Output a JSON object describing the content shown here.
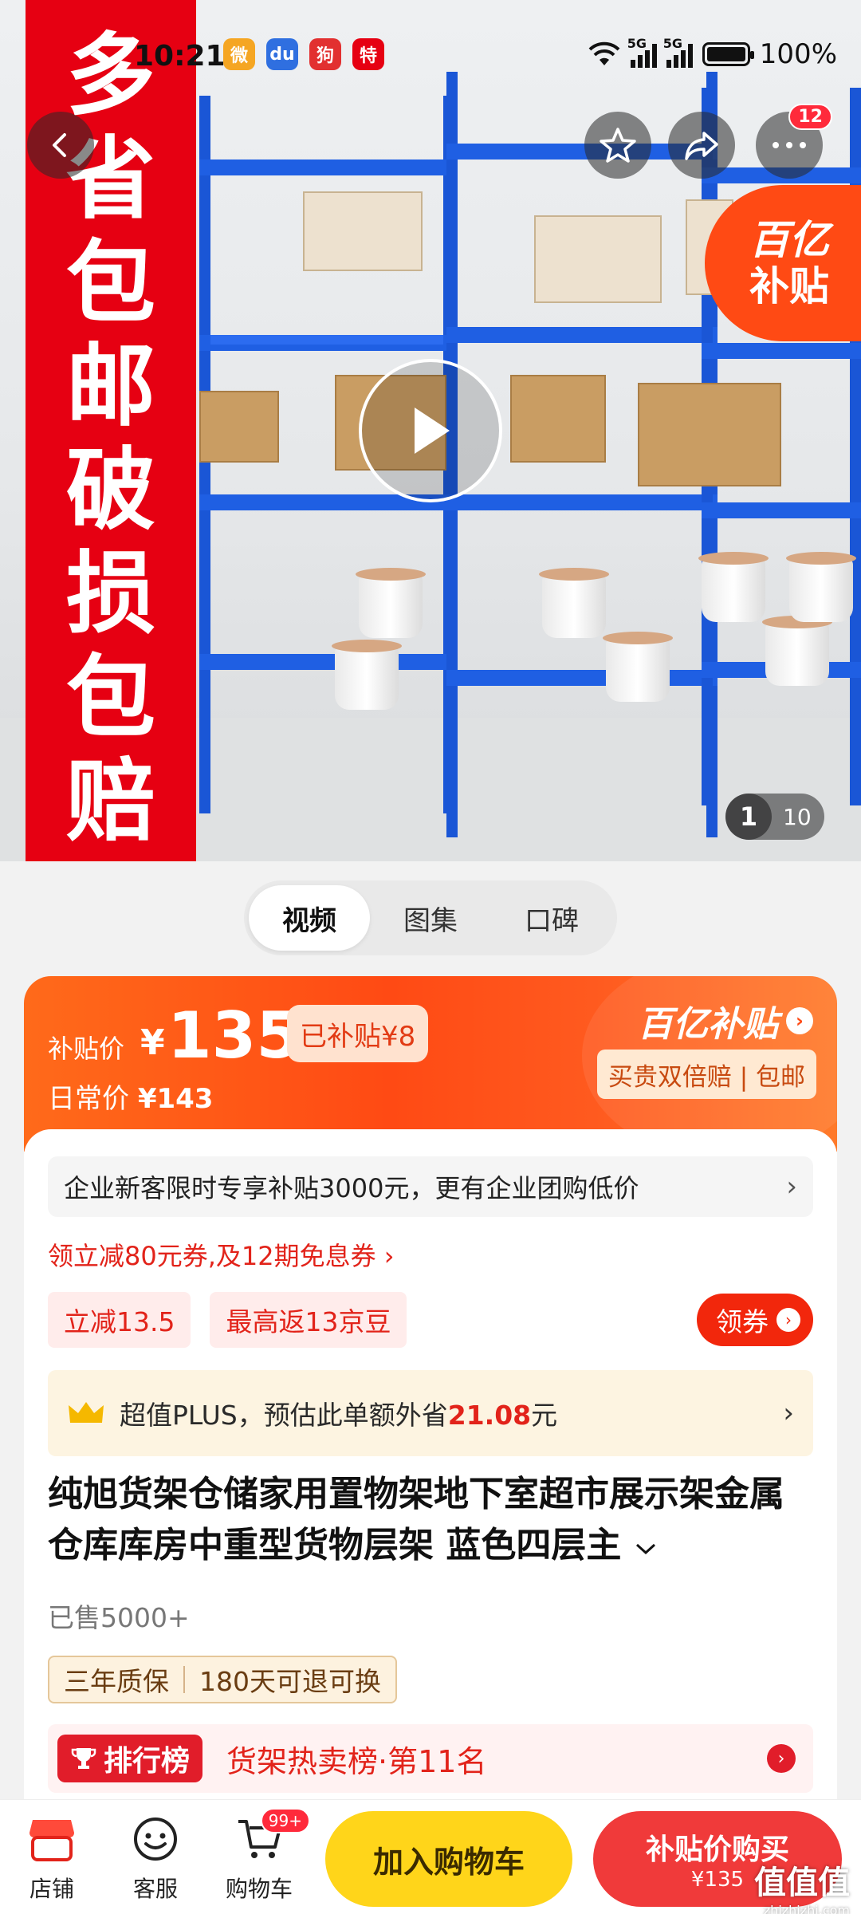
{
  "status_bar": {
    "time": "10:21",
    "network": "5G",
    "network2": "5G",
    "battery": "100%",
    "battery_level": 1.0,
    "app_icons": [
      "weibo-icon",
      "baidu-icon",
      "app-icon",
      "special-offer-icon"
    ],
    "app_icon_texts": [
      "微",
      "du",
      "狗",
      "特"
    ]
  },
  "hero": {
    "banner_lines": [
      "多",
      "省",
      "包",
      "邮",
      "破",
      "损",
      "包",
      "赔"
    ],
    "yi_badge_line1": "百亿",
    "yi_badge_line2": "补贴",
    "cart_count": "12",
    "counter_current": "1",
    "counter_total": "10"
  },
  "media_tabs": [
    "视频",
    "图集",
    "口碑"
  ],
  "price": {
    "label": "补贴价",
    "yen": "¥",
    "amount": "135",
    "subsidy_chip": "已补贴¥8",
    "daily_label": "日常价",
    "daily_price": "¥143",
    "brand": "百亿补贴",
    "guarantee": "买贵双倍赔 | 包邮"
  },
  "details": {
    "enterprise": "企业新客限时专享补贴3000元，更有企业团购低价",
    "coupon_line": "领立减80元券,及12期免息券",
    "tags": [
      "立减13.5",
      "最高返13京豆"
    ],
    "get_coupon": "领券",
    "plus_text": "超值PLUS，预估此单额外省",
    "plus_amount": "21.08",
    "plus_unit": "元",
    "title": "纯旭货架仓储家用置物架地下室超市展示架金属仓库库房中重型货物层架 蓝色四层主",
    "sold": "已售5000+",
    "services": [
      "三年质保",
      "180天可退可换"
    ],
    "rank_pill": "排行榜",
    "rank_text": "货架热卖榜·第11名"
  },
  "bottom": {
    "shop": "店铺",
    "service": "客服",
    "cart": "购物车",
    "cart_badge": "99+",
    "add_to_cart": "加入购物车",
    "buy_line1": "补贴价购买",
    "buy_line2": "¥135"
  },
  "watermark": {
    "line1": "值值值",
    "line2": "zhizhizhi.com"
  },
  "colors": {
    "jd_red": "#e60012",
    "subsidy_orange": "#ff4a14",
    "cart_yellow": "#ffd51a",
    "buy_red": "#f03a3a",
    "rack_blue": "#1a56d6"
  }
}
